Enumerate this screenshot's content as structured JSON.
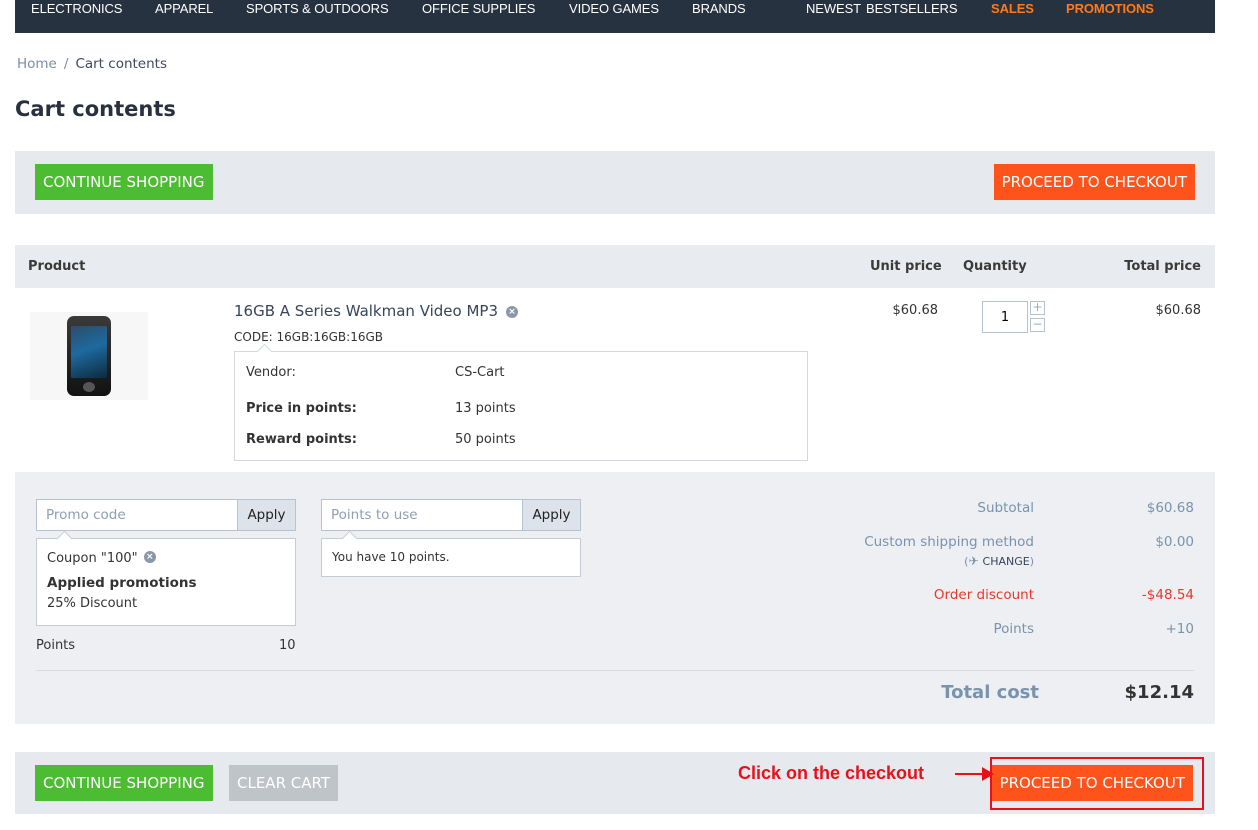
{
  "nav": {
    "items": [
      {
        "label": "ELECTRONICS",
        "highlight": false
      },
      {
        "label": "APPAREL",
        "highlight": false
      },
      {
        "label": "SPORTS & OUTDOORS",
        "highlight": false
      },
      {
        "label": "OFFICE SUPPLIES",
        "highlight": false
      },
      {
        "label": "VIDEO GAMES",
        "highlight": false
      },
      {
        "label": "BRANDS",
        "highlight": false
      },
      {
        "label": "NEWEST",
        "highlight": false
      },
      {
        "label": "BESTSELLERS",
        "highlight": false
      },
      {
        "label": "SALES",
        "highlight": true
      },
      {
        "label": "PROMOTIONS",
        "highlight": true
      }
    ]
  },
  "breadcrumb": {
    "home": "Home",
    "separator": "/",
    "current": "Cart contents"
  },
  "page": {
    "title": "Cart contents"
  },
  "top_bar": {
    "continue_label": "CONTINUE SHOPPING",
    "checkout_label": "PROCEED TO CHECKOUT"
  },
  "table": {
    "headers": {
      "product": "Product",
      "unit_price": "Unit price",
      "quantity": "Quantity",
      "total_price": "Total price"
    },
    "items": [
      {
        "name": "16GB A Series Walkman Video MP3",
        "remove_icon": "remove-circle-icon",
        "code": "CODE: 16GB:16GB:16GB",
        "details": {
          "vendor_label": "Vendor:",
          "vendor_value": "CS-Cart",
          "price_points_label": "Price in points:",
          "price_points_value": "13 points",
          "reward_points_label": "Reward points:",
          "reward_points_value": "50 points"
        },
        "unit_price": "$60.68",
        "quantity": "1",
        "qty_plus": "+",
        "qty_minus": "−",
        "total_price": "$60.68"
      }
    ]
  },
  "promo": {
    "placeholder": "Promo code",
    "apply_label": "Apply",
    "coupon": "Coupon \"100\"",
    "applied_title": "Applied promotions",
    "applied_item": "25% Discount",
    "points_label": "Points",
    "points_value": "10"
  },
  "points": {
    "placeholder": "Points to use",
    "apply_label": "Apply",
    "info": "You have 10 points."
  },
  "summary": {
    "subtotal_label": "Subtotal",
    "subtotal_value": "$60.68",
    "shipping_label": "Custom shipping method",
    "shipping_value": "$0.00",
    "change_open": "(",
    "change_icon": "airplane-icon",
    "change_label": "CHANGE",
    "change_close": ")",
    "discount_label": "Order discount",
    "discount_value": "-$48.54",
    "points_label": "Points",
    "points_value": "+10",
    "total_label": "Total cost",
    "total_value": "$12.14"
  },
  "bottom_bar": {
    "continue_label": "CONTINUE SHOPPING",
    "clear_label": "CLEAR CART",
    "checkout_label": "PROCEED TO CHECKOUT"
  },
  "annotation": {
    "text": "Click on the checkout",
    "color": "#e8101a"
  },
  "colors": {
    "nav_bg": "#263240",
    "promo_nav": "#ff7a1a",
    "green_button": "#4cbc32",
    "orange_button": "#fe541b",
    "grey_button": "#bfc4c9",
    "discount_red": "#e8382c"
  }
}
